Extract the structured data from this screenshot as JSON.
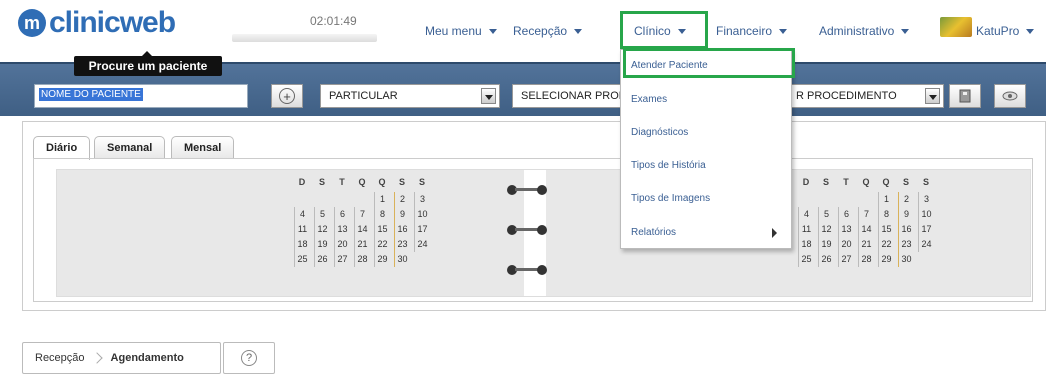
{
  "app": {
    "logo_badge": "m",
    "logo_text": "clinicweb"
  },
  "clock": "02:01:49",
  "nav": {
    "menu": "Meu menu",
    "recepcao": "Recepção",
    "clinico": "Clínico",
    "financeiro": "Financeiro",
    "administrativo": "Administrativo",
    "user": "KatuPro"
  },
  "tooltip": "Procure um paciente",
  "search": {
    "patient_value": "NOME DO PACIENTE",
    "convenio": "PARTICULAR",
    "profissional": "SELECIONAR PROF",
    "procedimento": "R PROCEDIMENTO"
  },
  "tabs": {
    "diario": "Diário",
    "semanal": "Semanal",
    "mensal": "Mensal"
  },
  "calendar": {
    "weekdays": [
      "D",
      "S",
      "T",
      "Q",
      "Q",
      "S",
      "S"
    ],
    "weeks": [
      [
        "",
        "",
        "",
        "",
        "1",
        "2",
        "3"
      ],
      [
        "4",
        "5",
        "6",
        "7",
        "8",
        "9",
        "10"
      ],
      [
        "11",
        "12",
        "13",
        "14",
        "15",
        "16",
        "17"
      ],
      [
        "18",
        "19",
        "20",
        "21",
        "22",
        "23",
        "24"
      ],
      [
        "25",
        "26",
        "27",
        "28",
        "29",
        "30",
        ""
      ]
    ]
  },
  "dropdown": {
    "atender": "Atender Paciente",
    "exames": "Exames",
    "diagnosticos": "Diagnósticos",
    "tipos_historia": "Tipos de História",
    "tipos_imagens": "Tipos de Imagens",
    "relatorios": "Relatórios"
  },
  "breadcrumb": {
    "recepcao": "Recepção",
    "agendamento": "Agendamento"
  },
  "help_label": "?",
  "colors": {
    "brand": "#2f6db5",
    "highlight": "#27a64a",
    "bar": "#3f5f84"
  }
}
